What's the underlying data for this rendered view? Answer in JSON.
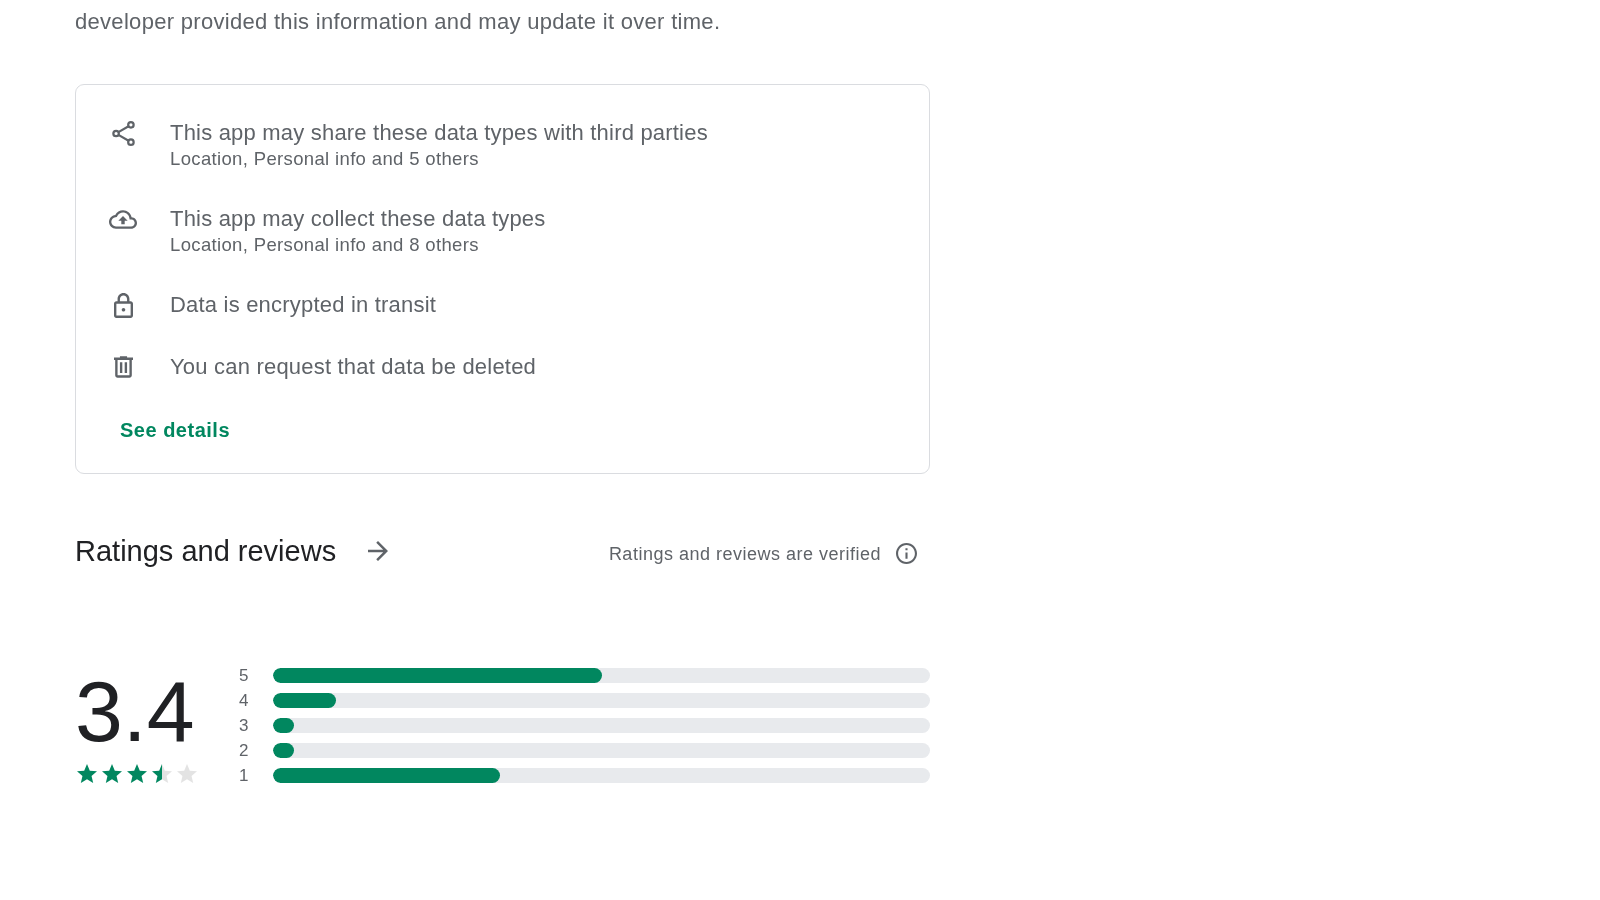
{
  "description": "developer provided this information and may update it over time.",
  "data_safety": {
    "items": [
      {
        "kind": "share",
        "title": "This app may share these data types with third parties",
        "subtitle": "Location, Personal info and 5 others"
      },
      {
        "kind": "collect",
        "title": "This app may collect these data types",
        "subtitle": "Location, Personal info and 8 others"
      },
      {
        "kind": "encrypted",
        "title": "Data is encrypted in transit"
      },
      {
        "kind": "deletion",
        "title": "You can request that data be deleted"
      }
    ],
    "link": "See details"
  },
  "ratings": {
    "title": "Ratings and reviews",
    "verified_note": "Ratings and reviews are verified",
    "score": "3.4",
    "stars": 3.5,
    "distribution": [
      {
        "label": "5",
        "level": 0.5
      },
      {
        "label": "4",
        "level": 0.096
      },
      {
        "label": "3",
        "level": 0.032
      },
      {
        "label": "2",
        "level": 0.032
      },
      {
        "label": "1",
        "level": 0.345
      }
    ]
  }
}
